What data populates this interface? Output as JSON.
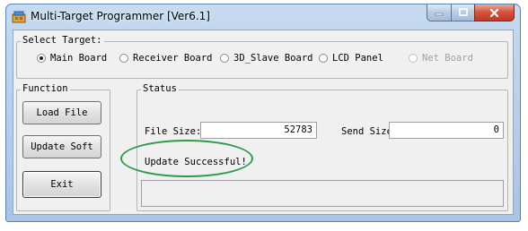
{
  "window": {
    "title": "Multi-Target Programmer [Ver6.1]",
    "controls": {
      "minimize": "minimize-icon",
      "maximize": "maximize-icon",
      "close": "close-icon"
    }
  },
  "select_target": {
    "label": "Select Target:",
    "options": [
      {
        "label": "Main Board",
        "selected": true,
        "enabled": true
      },
      {
        "label": "Receiver Board",
        "selected": false,
        "enabled": true
      },
      {
        "label": "3D_Slave Board",
        "selected": false,
        "enabled": true
      },
      {
        "label": "LCD Panel",
        "selected": false,
        "enabled": true
      },
      {
        "label": "Net Board",
        "selected": false,
        "enabled": false
      }
    ]
  },
  "function": {
    "label": "Function",
    "load_file": "Load File",
    "update_soft": "Update Soft",
    "exit": "Exit"
  },
  "status": {
    "label": "Status",
    "file_size_label": "File Size:",
    "file_size_value": "52783",
    "send_size_label": "Send Size",
    "send_size_value": "0",
    "message": "Update Successful!",
    "output": ""
  },
  "colors": {
    "highlight_ring": "#2f9a49",
    "close_button": "#c8432f",
    "title_bar": "#b9d1ea"
  }
}
